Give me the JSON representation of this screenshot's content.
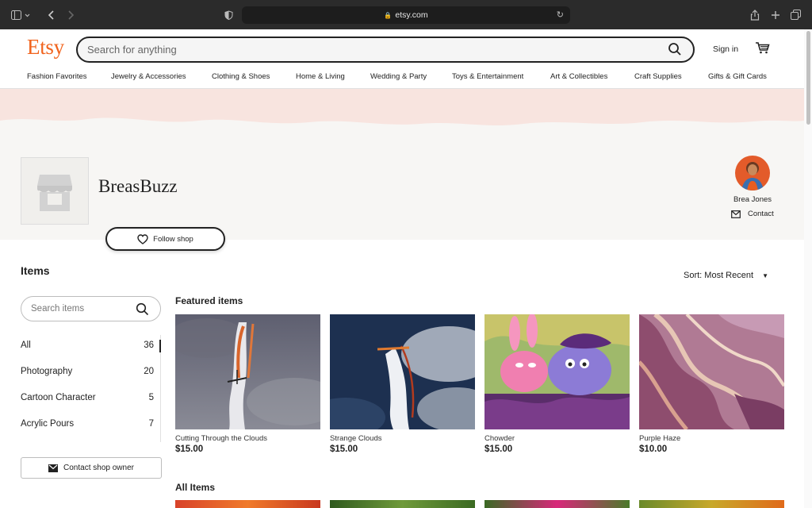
{
  "browser": {
    "url": "etsy.com"
  },
  "header": {
    "logo": "Etsy",
    "search_placeholder": "Search for anything",
    "signin": "Sign in",
    "categories": [
      "Fashion Favorites",
      "Jewelry & Accessories",
      "Clothing & Shoes",
      "Home & Living",
      "Wedding & Party",
      "Toys & Entertainment",
      "Art & Collectibles",
      "Craft Supplies",
      "Gifts & Gift Cards"
    ]
  },
  "shop": {
    "name": "BreasBuzz",
    "follow_label": "Follow shop",
    "owner_name": "Brea Jones",
    "contact_label": "Contact"
  },
  "items": {
    "heading": "Items",
    "sort_label": "Sort: Most Recent",
    "search_placeholder": "Search items",
    "sections": [
      {
        "label": "All",
        "count": "36"
      },
      {
        "label": "Photography",
        "count": "20"
      },
      {
        "label": "Cartoon Character",
        "count": "5"
      },
      {
        "label": "Acrylic Pours",
        "count": "7"
      }
    ],
    "contact_owner_label": "Contact shop owner",
    "featured_heading": "Featured items",
    "featured": [
      {
        "title": "Cutting Through the Clouds",
        "price": "$15.00"
      },
      {
        "title": "Strange Clouds",
        "price": "$15.00"
      },
      {
        "title": "Chowder",
        "price": "$15.00"
      },
      {
        "title": "Purple Haze",
        "price": "$10.00"
      }
    ],
    "all_heading": "All Items"
  },
  "colors": {
    "brand": "#f1641e",
    "banner": "#f8e4df"
  }
}
